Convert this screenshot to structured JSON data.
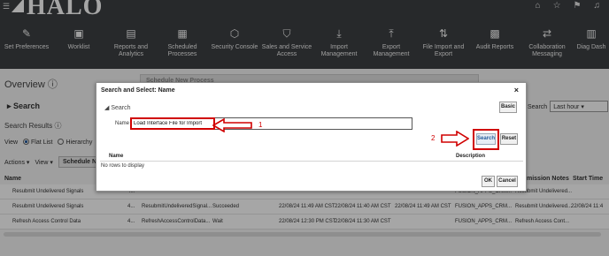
{
  "brand": {
    "logo_text": "HALO"
  },
  "header_icons": [
    "home-icon",
    "star-icon",
    "flag-icon",
    "bell-icon"
  ],
  "nav": {
    "items": [
      {
        "label": "Set Preferences",
        "icon": "gear-icon"
      },
      {
        "label": "Worklist",
        "icon": "clipboard-icon"
      },
      {
        "label": "Reports and Analytics",
        "icon": "chart-icon"
      },
      {
        "label": "Scheduled Processes",
        "icon": "calendar-icon"
      },
      {
        "label": "Security Console",
        "icon": "shield-icon"
      },
      {
        "label": "Sales and Service Access",
        "icon": "shield-check-icon"
      },
      {
        "label": "Import Management",
        "icon": "download-icon"
      },
      {
        "label": "Export Management",
        "icon": "upload-icon"
      },
      {
        "label": "File Import and Export",
        "icon": "arrows-icon"
      },
      {
        "label": "Audit Reports",
        "icon": "audit-icon"
      },
      {
        "label": "Collaboration Messaging",
        "icon": "exchange-icon"
      },
      {
        "label": "Diag Dash",
        "icon": "diagnostics-icon"
      }
    ]
  },
  "page": {
    "overview": "Overview",
    "search_header": "Search",
    "search_results": "Search Results",
    "view_label": "View",
    "view_flat": "Flat List",
    "view_hierarchy": "Hierarchy",
    "actions_label": "Actions",
    "view_menu": "View",
    "schedule_button": "Schedule Ne",
    "search_right_label": "Search",
    "time_filter": "Last hour",
    "bg_panel_title": "Schedule New Process",
    "columns": {
      "name": "Name",
      "submission_notes": "mission Notes",
      "start_time": "Start Time"
    },
    "rows": [
      {
        "name": "Resubmit Undelivered Signals",
        "num": "4...",
        "process": "ResubmitUndeliveredSignal...",
        "status": "Succeeded",
        "scheduled": "22/08/24 11:49 AM CST",
        "submitted": "22/08/24 11:40 AM CST",
        "completed": "22/08/24 11:49 AM CST",
        "user": "FUSION_APPS_CRM...",
        "notes": "Resubmit Undelivered...",
        "start": "22/08/24 11:4"
      },
      {
        "name": "Refresh Access Control Data",
        "num": "4...",
        "process": "RefreshAccessControlData...",
        "status": "Wait",
        "scheduled": "22/08/24 12:30 PM CST",
        "submitted": "22/08/24 11:30 AM CST",
        "completed": "",
        "user": "FUSION_APPS_CRM...",
        "notes": "Refresh Access Cont...",
        "start": ""
      }
    ],
    "partial_row": {
      "name": "Resubmit Undelivered Signals",
      "num": "4...",
      "user": "FUSION_APPS_CRM...",
      "notes": "Resubmit Undelivered..."
    }
  },
  "dialog": {
    "title": "Search and Select: Name",
    "section": "Search",
    "basic_button": "Basic",
    "name_label": "Name",
    "name_value": "Load Interface File for Import",
    "search_button": "Search",
    "reset_button": "Reset",
    "col_name": "Name",
    "col_description": "Description",
    "empty_message": "No rows to display",
    "ok_button": "OK",
    "cancel_button": "Cancel"
  },
  "annotations": {
    "step1": "1",
    "step2": "2",
    "color": "#d00000"
  }
}
